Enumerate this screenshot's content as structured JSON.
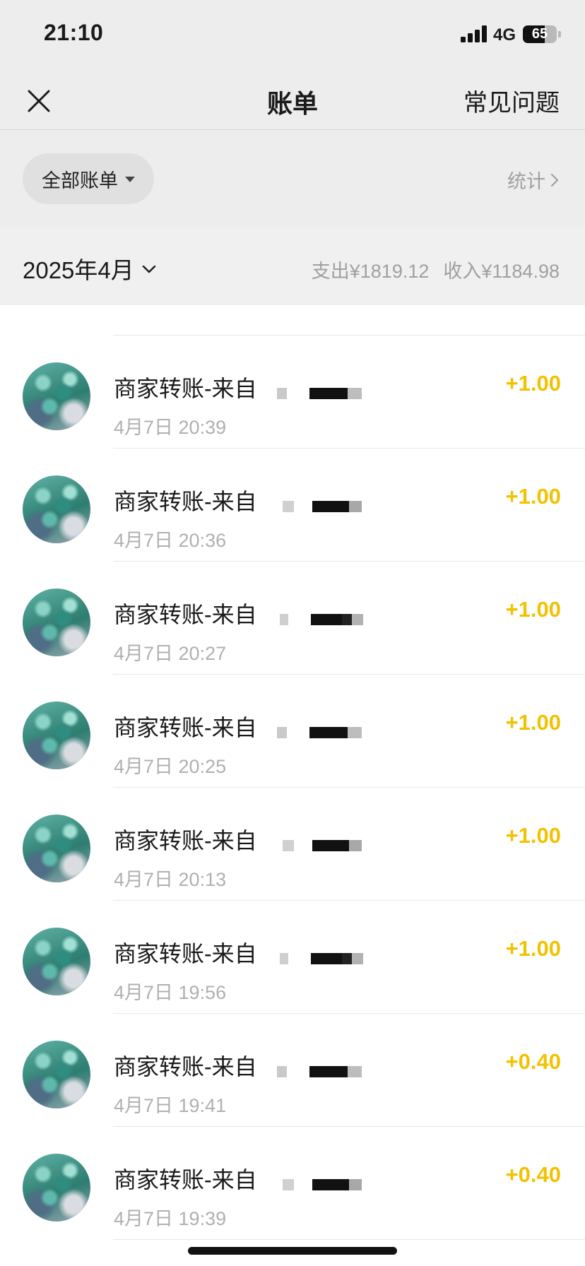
{
  "status_bar": {
    "time": "21:10",
    "network": "4G",
    "battery": "65"
  },
  "header": {
    "title": "账单",
    "faq_label": "常见问题"
  },
  "filter": {
    "label": "全部账单",
    "stats_label": "统计"
  },
  "month_bar": {
    "month": "2025年4月",
    "expense": "支出¥1819.12",
    "income": "收入¥1184.98"
  },
  "colors": {
    "income_amount": "#f2c200",
    "header_bg": "#ededed"
  },
  "icons": [
    "close-icon",
    "caret-down-icon",
    "chevron-right-icon",
    "chevron-down-icon",
    "signal-icon",
    "battery-icon"
  ],
  "transactions": [
    {
      "title": "商家转账-来自",
      "time": "4月7日 20:39",
      "amount": "+1.00"
    },
    {
      "title": "商家转账-来自",
      "time": "4月7日 20:36",
      "amount": "+1.00"
    },
    {
      "title": "商家转账-来自",
      "time": "4月7日 20:27",
      "amount": "+1.00"
    },
    {
      "title": "商家转账-来自",
      "time": "4月7日 20:25",
      "amount": "+1.00"
    },
    {
      "title": "商家转账-来自",
      "time": "4月7日 20:13",
      "amount": "+1.00"
    },
    {
      "title": "商家转账-来自",
      "time": "4月7日 19:56",
      "amount": "+1.00"
    },
    {
      "title": "商家转账-来自",
      "time": "4月7日 19:41",
      "amount": "+0.40"
    },
    {
      "title": "商家转账-来自",
      "time": "4月7日 19:39",
      "amount": "+0.40"
    }
  ]
}
